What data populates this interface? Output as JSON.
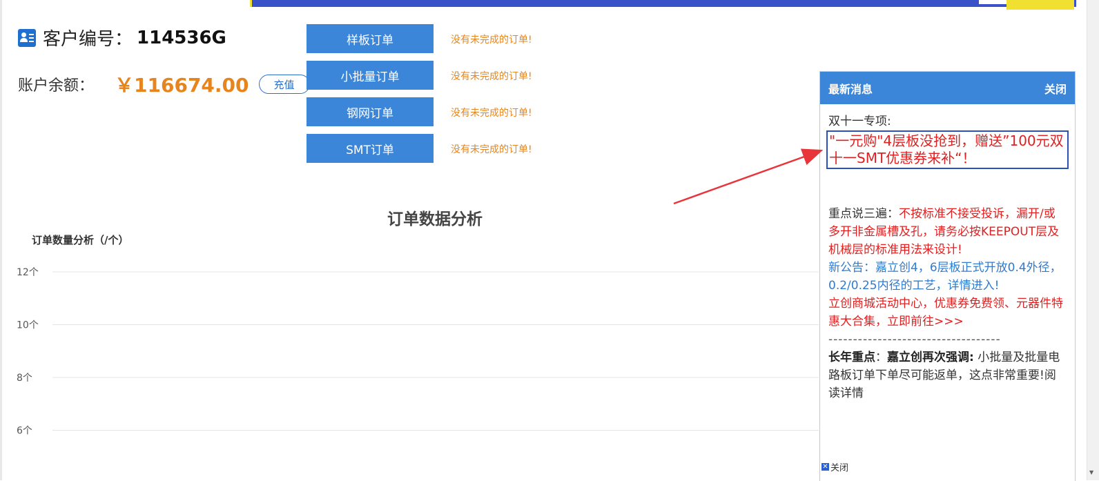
{
  "customer": {
    "label": "客户编号：",
    "number": "114536G"
  },
  "balance": {
    "label": "账户余额：",
    "value": "￥116674.00",
    "recharge_label": "充值"
  },
  "orders": [
    {
      "label": "样板订单",
      "status": "没有未完成的订单!"
    },
    {
      "label": "小批量订单",
      "status": "没有未完成的订单!"
    },
    {
      "label": "钢网订单",
      "status": "没有未完成的订单!"
    },
    {
      "label": "SMT订单",
      "status": "没有未完成的订单!"
    }
  ],
  "analysis": {
    "title": "订单数据分析"
  },
  "chart_data": {
    "type": "line",
    "title": "订单数量分析（/个）",
    "y_ticks": [
      "12个",
      "10个",
      "8个",
      "6个"
    ],
    "ylim": [
      6,
      12
    ],
    "grid": true,
    "series": []
  },
  "news": {
    "header_title": "最新消息",
    "header_close": "关闭",
    "intro": "双十一专项:",
    "promo": "\"一元购\"4层板没抢到，赠送”100元双十一SMT优惠券来补“！",
    "emphasis_prefix": "重点说三遍：",
    "emphasis_text": "不按标准不接受投诉，漏开/或多开非金属槽及孔，请务必按KEEPOUT层及机械层的标准用法来设计!",
    "announcement": "新公告：嘉立创4，6层板正式开放0.4外径，0.2/0.25内径的工艺，详情进入!",
    "mall": "立创商城活动中心，优惠券免费领、元器件特惠大合集，立即前往>>>",
    "divider": "-----------------------------------",
    "longterm_label": "长年重点",
    "longterm_sep": "：",
    "longterm_bold": "嘉立创再次强调:",
    "longterm_text": " 小批量及批量电路板订单下单尽可能返单，这点非常重要!阅读详情",
    "footer_close": "关闭"
  },
  "colors": {
    "accent_blue": "#3b86d9",
    "orange": "#e6851e",
    "red": "#e02020"
  }
}
